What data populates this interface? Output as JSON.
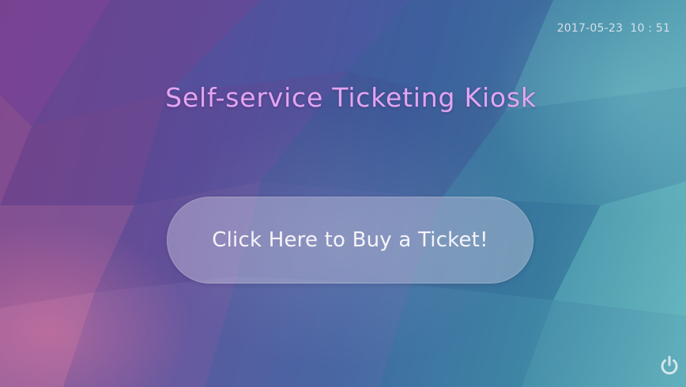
{
  "header": {
    "datetime": "2017-05-23  10 : 51"
  },
  "main": {
    "title": "Self-service Ticketing Kiosk",
    "buy_button_label": "Click Here to Buy a Ticket!"
  },
  "footer": {
    "power_icon": "power-icon"
  },
  "colors": {
    "title": "#e3a5f2",
    "button_text": "#f6f4fa",
    "background_left": "#6b3d86",
    "background_right": "#6fc0c4"
  }
}
